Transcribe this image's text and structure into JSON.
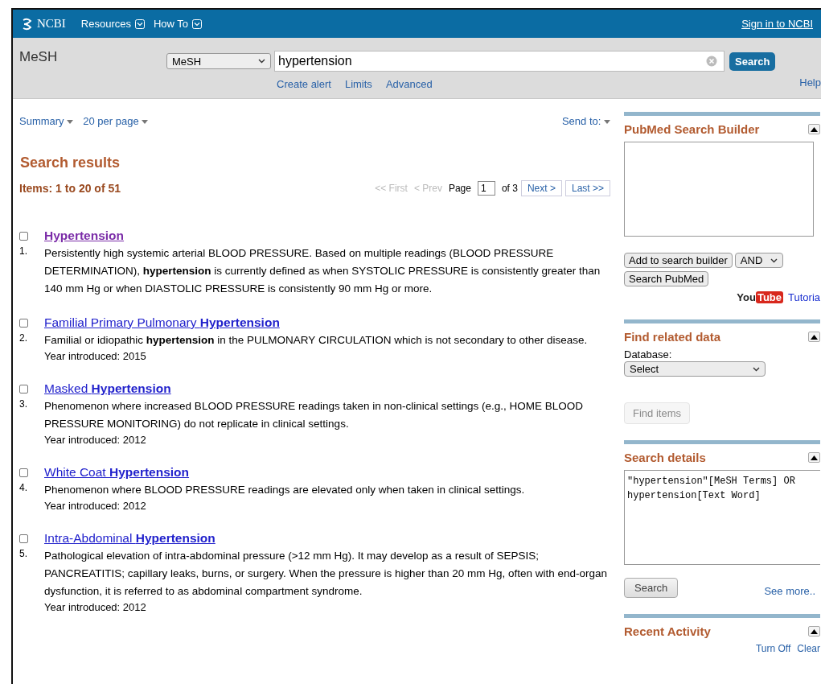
{
  "header": {
    "logo": "NCBI",
    "menus": [
      "Resources",
      "How To"
    ],
    "sign_in": "Sign in to NCBI"
  },
  "search_bar": {
    "title": "MeSH",
    "database": "MeSH",
    "query": "hypertension",
    "button": "Search",
    "links": [
      "Create alert",
      "Limits",
      "Advanced"
    ],
    "help": "Help"
  },
  "toolbar": {
    "format": "Summary",
    "per_page": "20 per page",
    "send_to": "Send to:"
  },
  "results": {
    "heading": "Search results",
    "count": "Items: 1 to 20 of 51",
    "pager": {
      "first": "<< First",
      "prev": "< Prev",
      "page_label": "Page",
      "page": "1",
      "of": "of 3",
      "next": "Next >",
      "last": "Last >>"
    },
    "items": [
      {
        "number": "1.",
        "title": "Hypertension",
        "visited": true,
        "checked": false,
        "description": "Persistently high systemic arterial BLOOD PRESSURE. Based on multiple readings (BLOOD PRESSURE DETERMINATION), **hypertension** is currently defined as when SYSTOLIC PRESSURE is consistently greater than 140 mm Hg or when DIASTOLIC PRESSURE is consistently 90 mm Hg or more."
      },
      {
        "number": "2.",
        "title": "Familial Primary Pulmonary **Hypertension**",
        "visited": false,
        "checked": false,
        "description": "Familial or idiopathic **hypertension** in the PULMONARY CIRCULATION which is not secondary to other disease.",
        "year": "Year introduced: 2015"
      },
      {
        "number": "3.",
        "title": "Masked **Hypertension**",
        "visited": false,
        "checked": false,
        "description": "Phenomenon where increased BLOOD PRESSURE readings taken in non-clinical settings (e.g., HOME BLOOD PRESSURE MONITORING) do not replicate in clinical settings.",
        "year": "Year introduced: 2012"
      },
      {
        "number": "4.",
        "title": "White Coat **Hypertension**",
        "visited": false,
        "checked": false,
        "description": "Phenomenon where BLOOD PRESSURE readings are elevated only when taken in clinical settings.",
        "year": "Year introduced: 2012"
      },
      {
        "number": "5.",
        "title": "Intra-Abdominal **Hypertension**",
        "visited": false,
        "checked": false,
        "description": "Pathological elevation of intra-abdominal pressure (>12 mm Hg). It may develop as a result of SEPSIS; PANCREATITIS; capillary leaks, burns, or surgery. When the pressure is higher than 20 mm Hg, often with end-organ dysfunction, it is referred to as abdominal compartment syndrome.",
        "year": "Year introduced: 2012"
      }
    ]
  },
  "sidebar": {
    "builder": {
      "title": "PubMed Search Builder",
      "add_button": "Add to search builder",
      "operator": "AND",
      "search_button": "Search PubMed",
      "youtube": [
        "You",
        "Tube"
      ],
      "tutorial": "Tutoria"
    },
    "related": {
      "title": "Find related data",
      "label": "Database:",
      "select": "Select",
      "button": "Find items",
      "button_disabled": true
    },
    "details": {
      "title": "Search details",
      "query": "\"hypertension\"[MeSH Terms] OR hypertension[Text Word]",
      "button": "Search",
      "more": "See more.."
    },
    "recent": {
      "title": "Recent Activity",
      "links": [
        "Turn Off",
        "Clear"
      ]
    }
  }
}
